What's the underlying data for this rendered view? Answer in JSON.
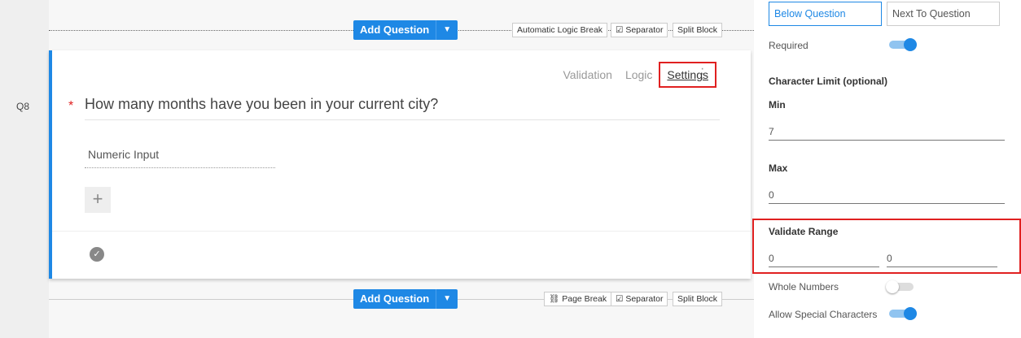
{
  "question_number": "Q8",
  "toolbar_top": {
    "add_question": "Add Question",
    "buttons": [
      "Automatic Logic Break",
      "☑ Separator",
      "Split Block"
    ]
  },
  "toolbar_bottom": {
    "add_question": "Add Question",
    "buttons": [
      "⛓ Page Break",
      "☑ Separator",
      "Split Block"
    ]
  },
  "question": {
    "tabs": [
      "Validation",
      "Logic",
      "Settings"
    ],
    "active_tab": "Settings",
    "required_mark": "*",
    "text": "How many months have you been in your current city?",
    "answer_type": "Numeric Input",
    "add": "+"
  },
  "settings": {
    "position_options": [
      "Below Question",
      "Next To Question"
    ],
    "required_label": "Required",
    "required": true,
    "char_limit_label": "Character Limit (optional)",
    "min_label": "Min",
    "min_value": "7",
    "max_label": "Max",
    "max_value": "0",
    "validate_range_label": "Validate Range",
    "range_from": "0",
    "range_to": "0",
    "whole_numbers_label": "Whole Numbers",
    "whole_numbers": false,
    "special_chars_label": "Allow Special Characters",
    "special_chars": true
  }
}
